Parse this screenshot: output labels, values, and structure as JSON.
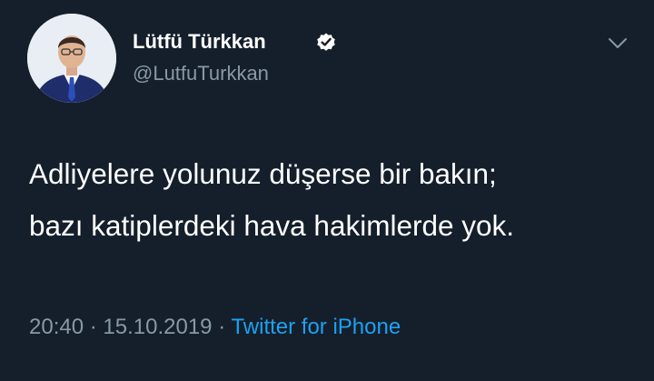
{
  "author": {
    "display_name": "Lütfü Türkkan",
    "handle": "@LutfuTurkkan",
    "verified": true
  },
  "tweet": {
    "lines": [
      "Adliyelere yolunuz düşerse bir bakın;",
      "bazı katiplerdeki hava hakimlerde yok."
    ]
  },
  "meta": {
    "time": "20:40",
    "separator": "·",
    "date": "15.10.2019",
    "source": "Twitter for iPhone"
  },
  "icons": {
    "verified": "verified-badge-icon",
    "more": "chevron-down-icon"
  },
  "colors": {
    "background": "#151f2b",
    "text": "#ffffff",
    "secondary": "#8899a6",
    "link": "#1da1f2"
  }
}
